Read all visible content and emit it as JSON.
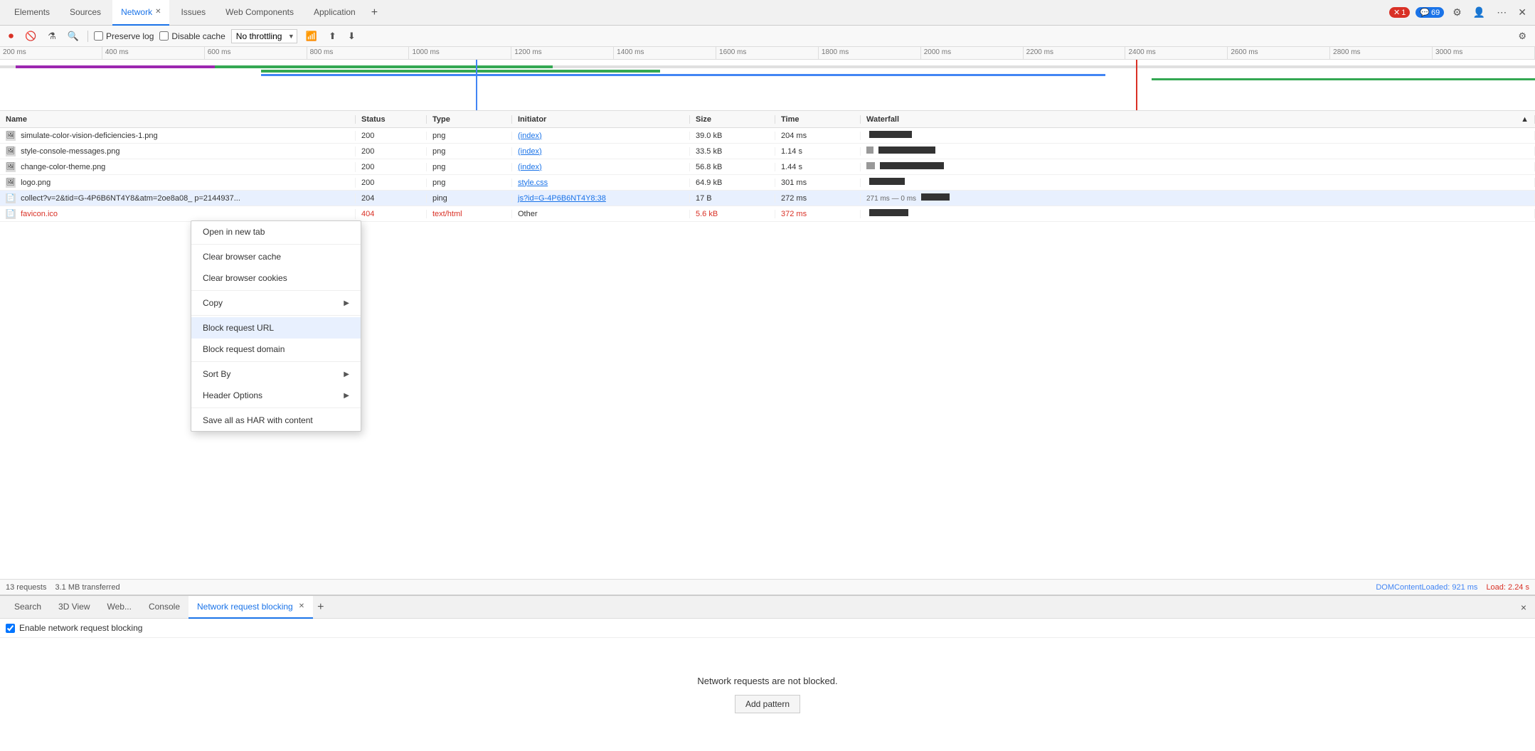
{
  "tabs": {
    "items": [
      {
        "label": "Elements",
        "active": false
      },
      {
        "label": "Sources",
        "active": false
      },
      {
        "label": "Network",
        "active": true
      },
      {
        "label": "Issues",
        "active": false
      },
      {
        "label": "Web Components",
        "active": false
      },
      {
        "label": "Application",
        "active": false
      }
    ],
    "add_label": "+"
  },
  "header_right": {
    "error_count": "1",
    "info_count": "69"
  },
  "toolbar": {
    "preserve_log": "Preserve log",
    "disable_cache": "Disable cache",
    "throttle_label": "No throttling"
  },
  "timeline": {
    "ticks": [
      "200 ms",
      "400 ms",
      "600 ms",
      "800 ms",
      "1000 ms",
      "1200 ms",
      "1400 ms",
      "1600 ms",
      "1800 ms",
      "2000 ms",
      "2200 ms",
      "2400 ms",
      "2600 ms",
      "2800 ms",
      "3000 ms"
    ]
  },
  "table": {
    "headers": [
      "Name",
      "Status",
      "Type",
      "Initiator",
      "Size",
      "Time",
      "Waterfall"
    ],
    "rows": [
      {
        "name": "simulate-color-vision-deficiencies-1.png",
        "status": "200",
        "type": "png",
        "initiator": "(index)",
        "initiator_link": true,
        "size": "39.0 kB",
        "time": "204 ms",
        "selected": false
      },
      {
        "name": "style-console-messages.png",
        "status": "200",
        "type": "png",
        "initiator": "(index)",
        "initiator_link": true,
        "size": "33.5 kB",
        "time": "1.14 s",
        "selected": false
      },
      {
        "name": "change-color-theme.png",
        "status": "200",
        "type": "png",
        "initiator": "(index)",
        "initiator_link": true,
        "size": "56.8 kB",
        "time": "1.44 s",
        "selected": false
      },
      {
        "name": "logo.png",
        "status": "200",
        "type": "png",
        "initiator": "style.css",
        "initiator_link": true,
        "size": "64.9 kB",
        "time": "301 ms",
        "selected": false
      },
      {
        "name": "collect?v=2&tid=G-4P6B6NT4Y8&atm=2oe8a08_ p=2144937...",
        "status": "204",
        "type": "ping",
        "initiator": "js?id=G-4P6B6NT4Y8:38",
        "initiator_link": true,
        "size": "17 B",
        "time": "272 ms",
        "waterfall_extra": "271 ms — 0 ms",
        "selected": true
      },
      {
        "name": "favicon.ico",
        "status": "404",
        "type": "text/html",
        "initiator": "Other",
        "initiator_link": false,
        "size": "5.6 kB",
        "time": "372 ms",
        "is_error": true,
        "selected": false
      }
    ]
  },
  "status_bar": {
    "requests": "13 requests",
    "transferred": "3.1 MB transferred",
    "dom_content": "DOMContentLoaded: 921 ms",
    "load": "Load: 2.24 s"
  },
  "bottom_panel": {
    "tabs": [
      {
        "label": "Search",
        "active": false
      },
      {
        "label": "3D View",
        "active": false
      },
      {
        "label": "Web...",
        "active": false
      },
      {
        "label": "Console",
        "active": false
      },
      {
        "label": "Network request blocking",
        "active": true
      }
    ],
    "not_blocked_text": "Network requests are not blocked.",
    "add_pattern_label": "Add pattern",
    "enable_label": "Enable network request blocking",
    "close_label": "×"
  },
  "context_menu": {
    "items": [
      {
        "label": "Open in new tab",
        "has_arrow": false,
        "highlighted": false
      },
      {
        "label": "Clear browser cache",
        "has_arrow": false,
        "highlighted": false
      },
      {
        "label": "Clear browser cookies",
        "has_arrow": false,
        "highlighted": false
      },
      {
        "label": "Copy",
        "has_arrow": true,
        "highlighted": false
      },
      {
        "label": "Block request URL",
        "has_arrow": false,
        "highlighted": true
      },
      {
        "label": "Block request domain",
        "has_arrow": false,
        "highlighted": false
      },
      {
        "label": "Sort By",
        "has_arrow": true,
        "highlighted": false
      },
      {
        "label": "Header Options",
        "has_arrow": true,
        "highlighted": false
      },
      {
        "label": "Save all as HAR with content",
        "has_arrow": false,
        "highlighted": false
      }
    ]
  }
}
